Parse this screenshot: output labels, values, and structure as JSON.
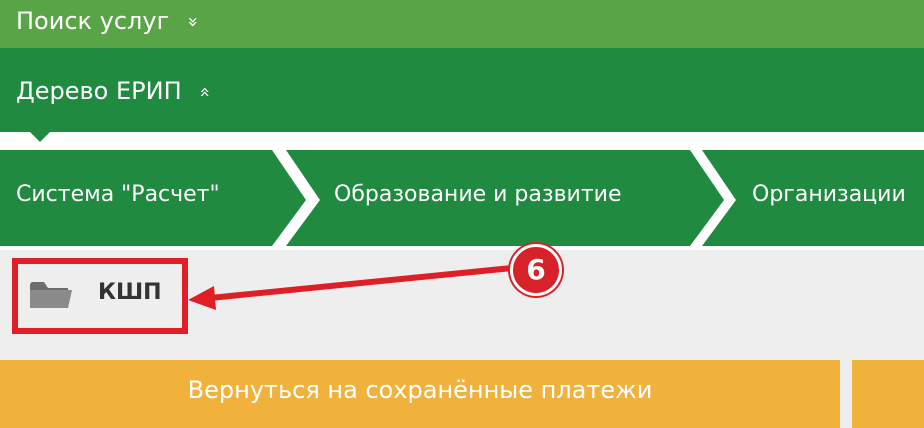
{
  "search": {
    "label": "Поиск услуг",
    "toggle_glyph": "»"
  },
  "tree": {
    "label": "Дерево ЕРИП",
    "toggle_glyph": "«"
  },
  "breadcrumbs": [
    {
      "label": "Система \"Расчет\""
    },
    {
      "label": "Образование и развитие"
    },
    {
      "label": "Организации"
    }
  ],
  "folder": {
    "label": "КШП",
    "icon": "folder-icon"
  },
  "annotation": {
    "step": "6"
  },
  "actions": {
    "back_label": "Вернуться на сохранённые платежи"
  },
  "colors": {
    "search_bar": "#5aa448",
    "tree_bar": "#1f8a40",
    "annotation": "#e01e26",
    "button": "#f0b23c"
  }
}
